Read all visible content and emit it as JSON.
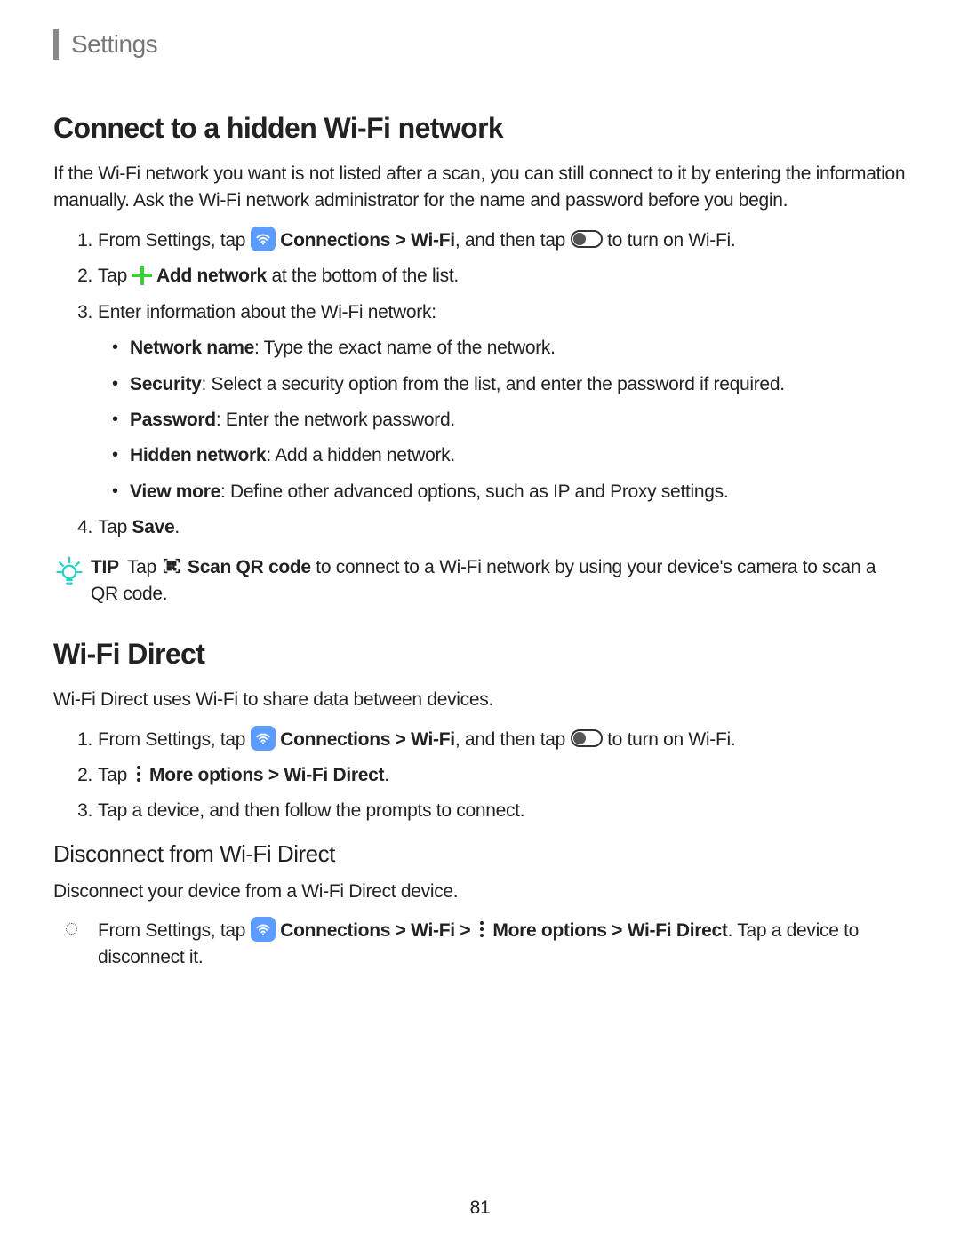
{
  "header": "Settings",
  "section1": {
    "title": "Connect to a hidden Wi-Fi network",
    "intro": "If the Wi-Fi network you want is not listed after a scan, you can still connect to it by entering the information manually. Ask the Wi-Fi network administrator for the name and password before you begin.",
    "step1_pre": "From Settings, tap ",
    "step1_b1": "Connections",
    "step1_gt": " > ",
    "step1_b2": "Wi-Fi",
    "step1_mid": ", and then tap ",
    "step1_post": " to turn on Wi-Fi.",
    "step2_pre": "Tap ",
    "step2_b": "Add network",
    "step2_post": " at the bottom of the list.",
    "step3": "Enter information about the Wi-Fi network:",
    "sub": {
      "a_b": "Network name",
      "a_t": ": Type the exact name of the network.",
      "b_b": "Security",
      "b_t": ": Select a security option from the list, and enter the password if required.",
      "c_b": "Password",
      "c_t": ": Enter the network password.",
      "d_b": "Hidden network",
      "d_t": ": Add a hidden network.",
      "e_b": "View more",
      "e_t": ": Define other advanced options, such as IP and Proxy settings."
    },
    "step4_pre": "Tap ",
    "step4_b": "Save",
    "step4_post": "."
  },
  "tip": {
    "label": "TIP",
    "pre": "Tap ",
    "b": "Scan QR code",
    "post": " to connect to a Wi-Fi network by using your device's camera to scan a QR code."
  },
  "section2": {
    "title": "Wi-Fi Direct",
    "intro": "Wi-Fi Direct uses Wi-Fi to share data between devices.",
    "step1_pre": "From Settings, tap ",
    "step1_b1": "Connections",
    "step1_gt": " > ",
    "step1_b2": "Wi-Fi",
    "step1_mid": ", and then tap ",
    "step1_post": " to turn on Wi-Fi.",
    "step2_pre": "Tap ",
    "step2_b1": "More options",
    "step2_gt": " > ",
    "step2_b2": "Wi-Fi Direct",
    "step2_post": ".",
    "step3": "Tap a device, and then follow the prompts to connect."
  },
  "section3": {
    "title": "Disconnect from Wi-Fi Direct",
    "intro": "Disconnect your device from a Wi-Fi Direct device.",
    "step_pre": "From Settings, tap ",
    "step_b1": "Connections",
    "step_gt1": " > ",
    "step_b2": "Wi-Fi",
    "step_gt2": " > ",
    "step_b3": "More options",
    "step_gt3": " > ",
    "step_b4": "Wi-Fi Direct",
    "step_post": ". Tap a device to disconnect it."
  },
  "pageNumber": "81",
  "nums": {
    "n1": "1.",
    "n2": "2.",
    "n3": "3.",
    "n4": "4."
  }
}
